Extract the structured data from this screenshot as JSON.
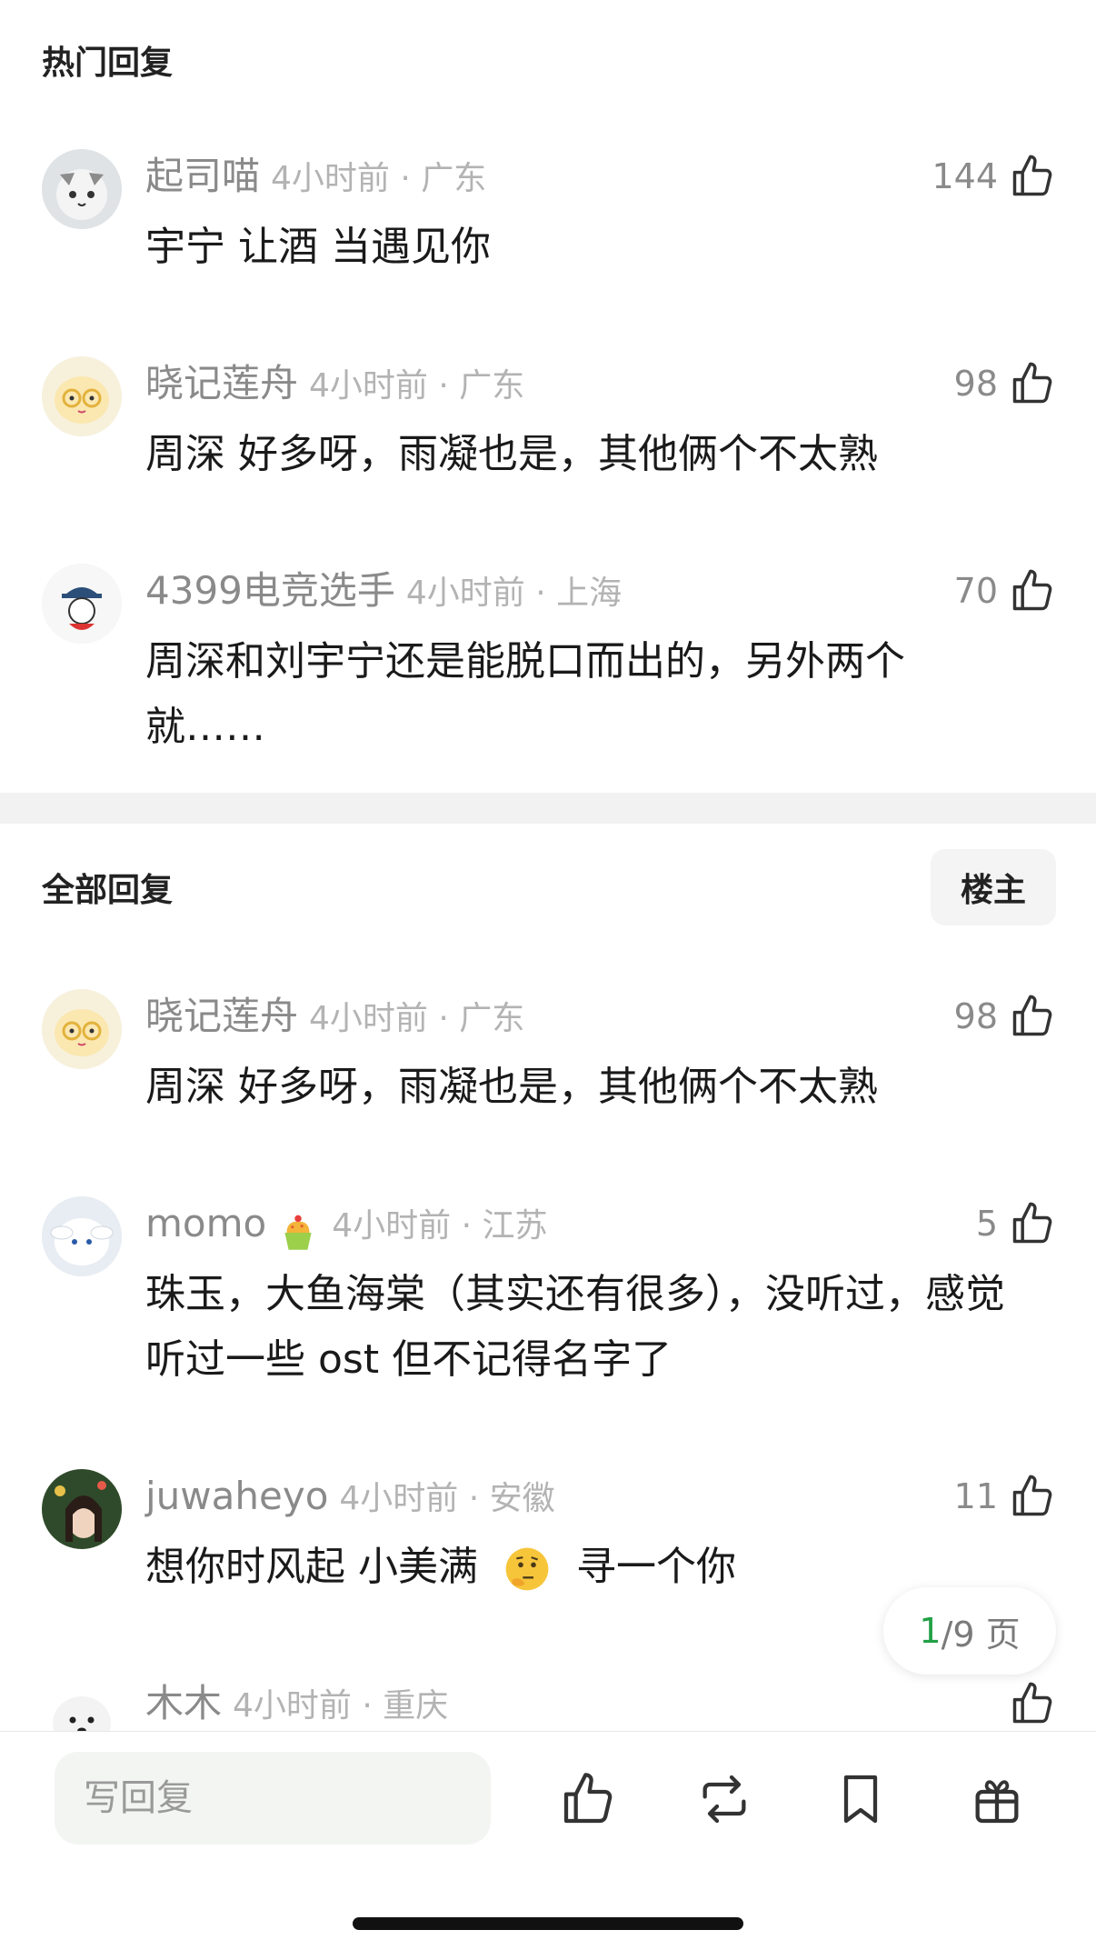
{
  "hot_section": {
    "title": "热门回复",
    "comments": [
      {
        "name": "起司喵",
        "meta": "4小时前 · 广东",
        "likes": "144",
        "text": "宇宁 让酒  当遇见你"
      },
      {
        "name": "晓记莲舟",
        "meta": "4小时前 · 广东",
        "likes": "98",
        "text": "周深 好多呀，雨凝也是，其他俩个不太熟"
      },
      {
        "name": "4399电竞选手",
        "meta": "4小时前 · 上海",
        "likes": "70",
        "text": "周深和刘宇宁还是能脱口而出的，另外两个就……"
      }
    ]
  },
  "all_section": {
    "title": "全部回复",
    "owner_button": "楼主",
    "comments": [
      {
        "name": "晓记莲舟",
        "meta": "4小时前 · 广东",
        "likes": "98",
        "text": "周深 好多呀，雨凝也是，其他俩个不太熟"
      },
      {
        "name": "momo",
        "meta": "4小时前 · 江苏",
        "likes": "5",
        "badge": "cupcake-emoji",
        "text": "珠玉，大鱼海棠（其实还有很多），没听过，感觉听过一些 ost 但不记得名字了"
      },
      {
        "name": "juwaheyo",
        "meta": "4小时前 · 安徽",
        "likes": "11",
        "text_a": "想你时风起 小美满",
        "text_b": "寻一个你",
        "inline_emoji": "thinking-face-emoji"
      },
      {
        "name": "木木",
        "meta": "4小时前 · 重庆",
        "likes": ""
      }
    ]
  },
  "page_indicator": {
    "current": "1",
    "rest": "/9 页"
  },
  "bottom_bar": {
    "reply_placeholder": "写回复",
    "icons": [
      "thumb-up-icon",
      "repost-icon",
      "bookmark-icon",
      "gift-icon"
    ]
  },
  "colors": {
    "accent_green": "#21a045",
    "meta_gray": "#b3b3b3",
    "name_gray": "#8a8a8a"
  }
}
